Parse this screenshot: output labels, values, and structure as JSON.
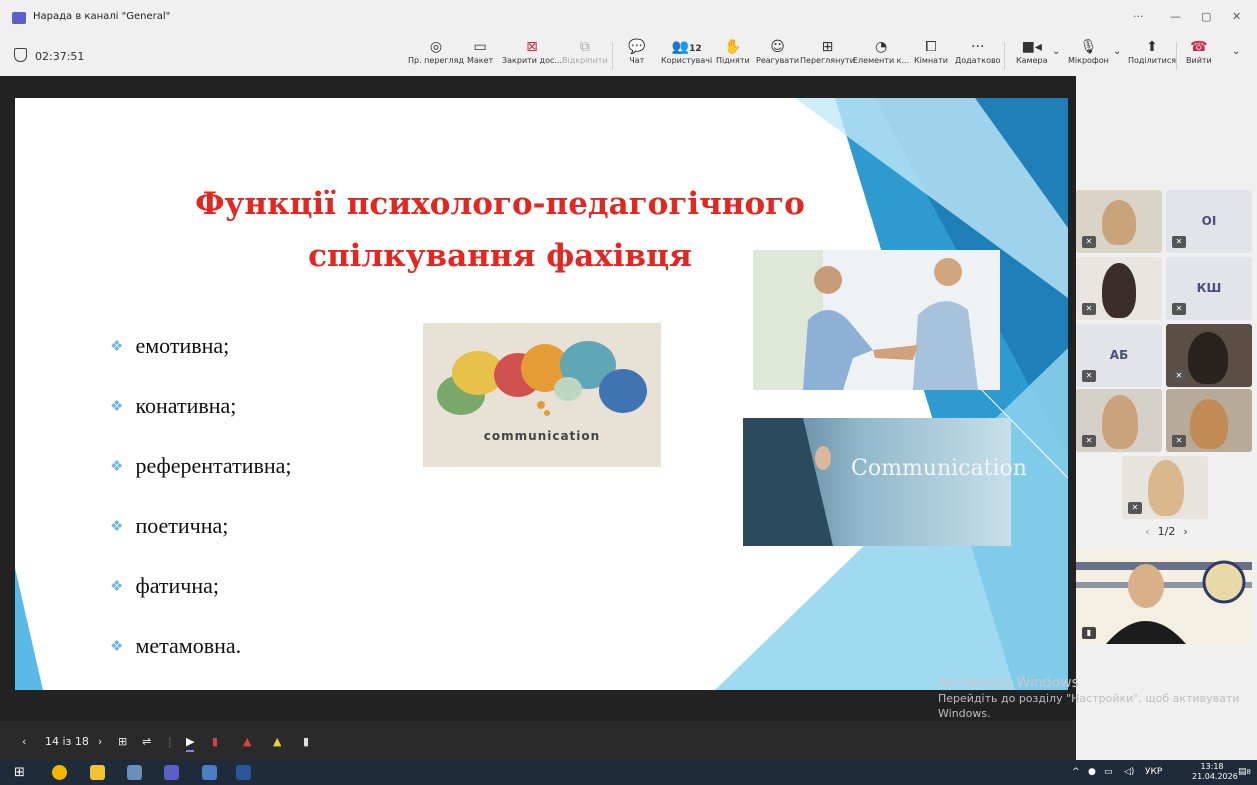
{
  "window": {
    "title": "Нарада в каналі \"General\""
  },
  "meeting": {
    "timer": "02:37:51"
  },
  "toolbar": {
    "preview": "Пр. перегляд",
    "layout": "Макет",
    "close_doc": "Закрити дос...",
    "unpin": "Відкріпити",
    "chat": "Чат",
    "users": "Користувачі",
    "users_count": "12",
    "raise": "Підняти",
    "react": "Реагувати",
    "view": "Переглянути",
    "elements": "Елементи к...",
    "rooms": "Кімнати",
    "more": "Додатково",
    "camera": "Камера",
    "mic": "Мікрофон",
    "share": "Поділитися",
    "leave": "Вийти"
  },
  "slide": {
    "title_line1": "Функції психолого-педагогічного",
    "title_line2": "спілкування фахівця",
    "bullets": [
      "емотивна;",
      "конативна;",
      "референтативна;",
      "поетична;",
      "фатична;",
      "метамовна."
    ],
    "image1_caption": "communication",
    "image3_text": "Communication"
  },
  "slide_controls": {
    "page": "14 із 18"
  },
  "participants": {
    "initials": [
      "ОІ",
      "КШ",
      "АБ"
    ],
    "pager": "1/2"
  },
  "watermark": {
    "title": "Активація Windows",
    "line1": "Перейдіть до розділу \"Настройки\", щоб активувати",
    "line2": "Windows."
  },
  "taskbar": {
    "lang": "УКР",
    "time": "13:18",
    "date": "21.04.2026",
    "notif_count": "8"
  },
  "colors": {
    "title_red": "#e32620",
    "accent": "#5b5fc7",
    "leave_red": "#c4314b"
  }
}
